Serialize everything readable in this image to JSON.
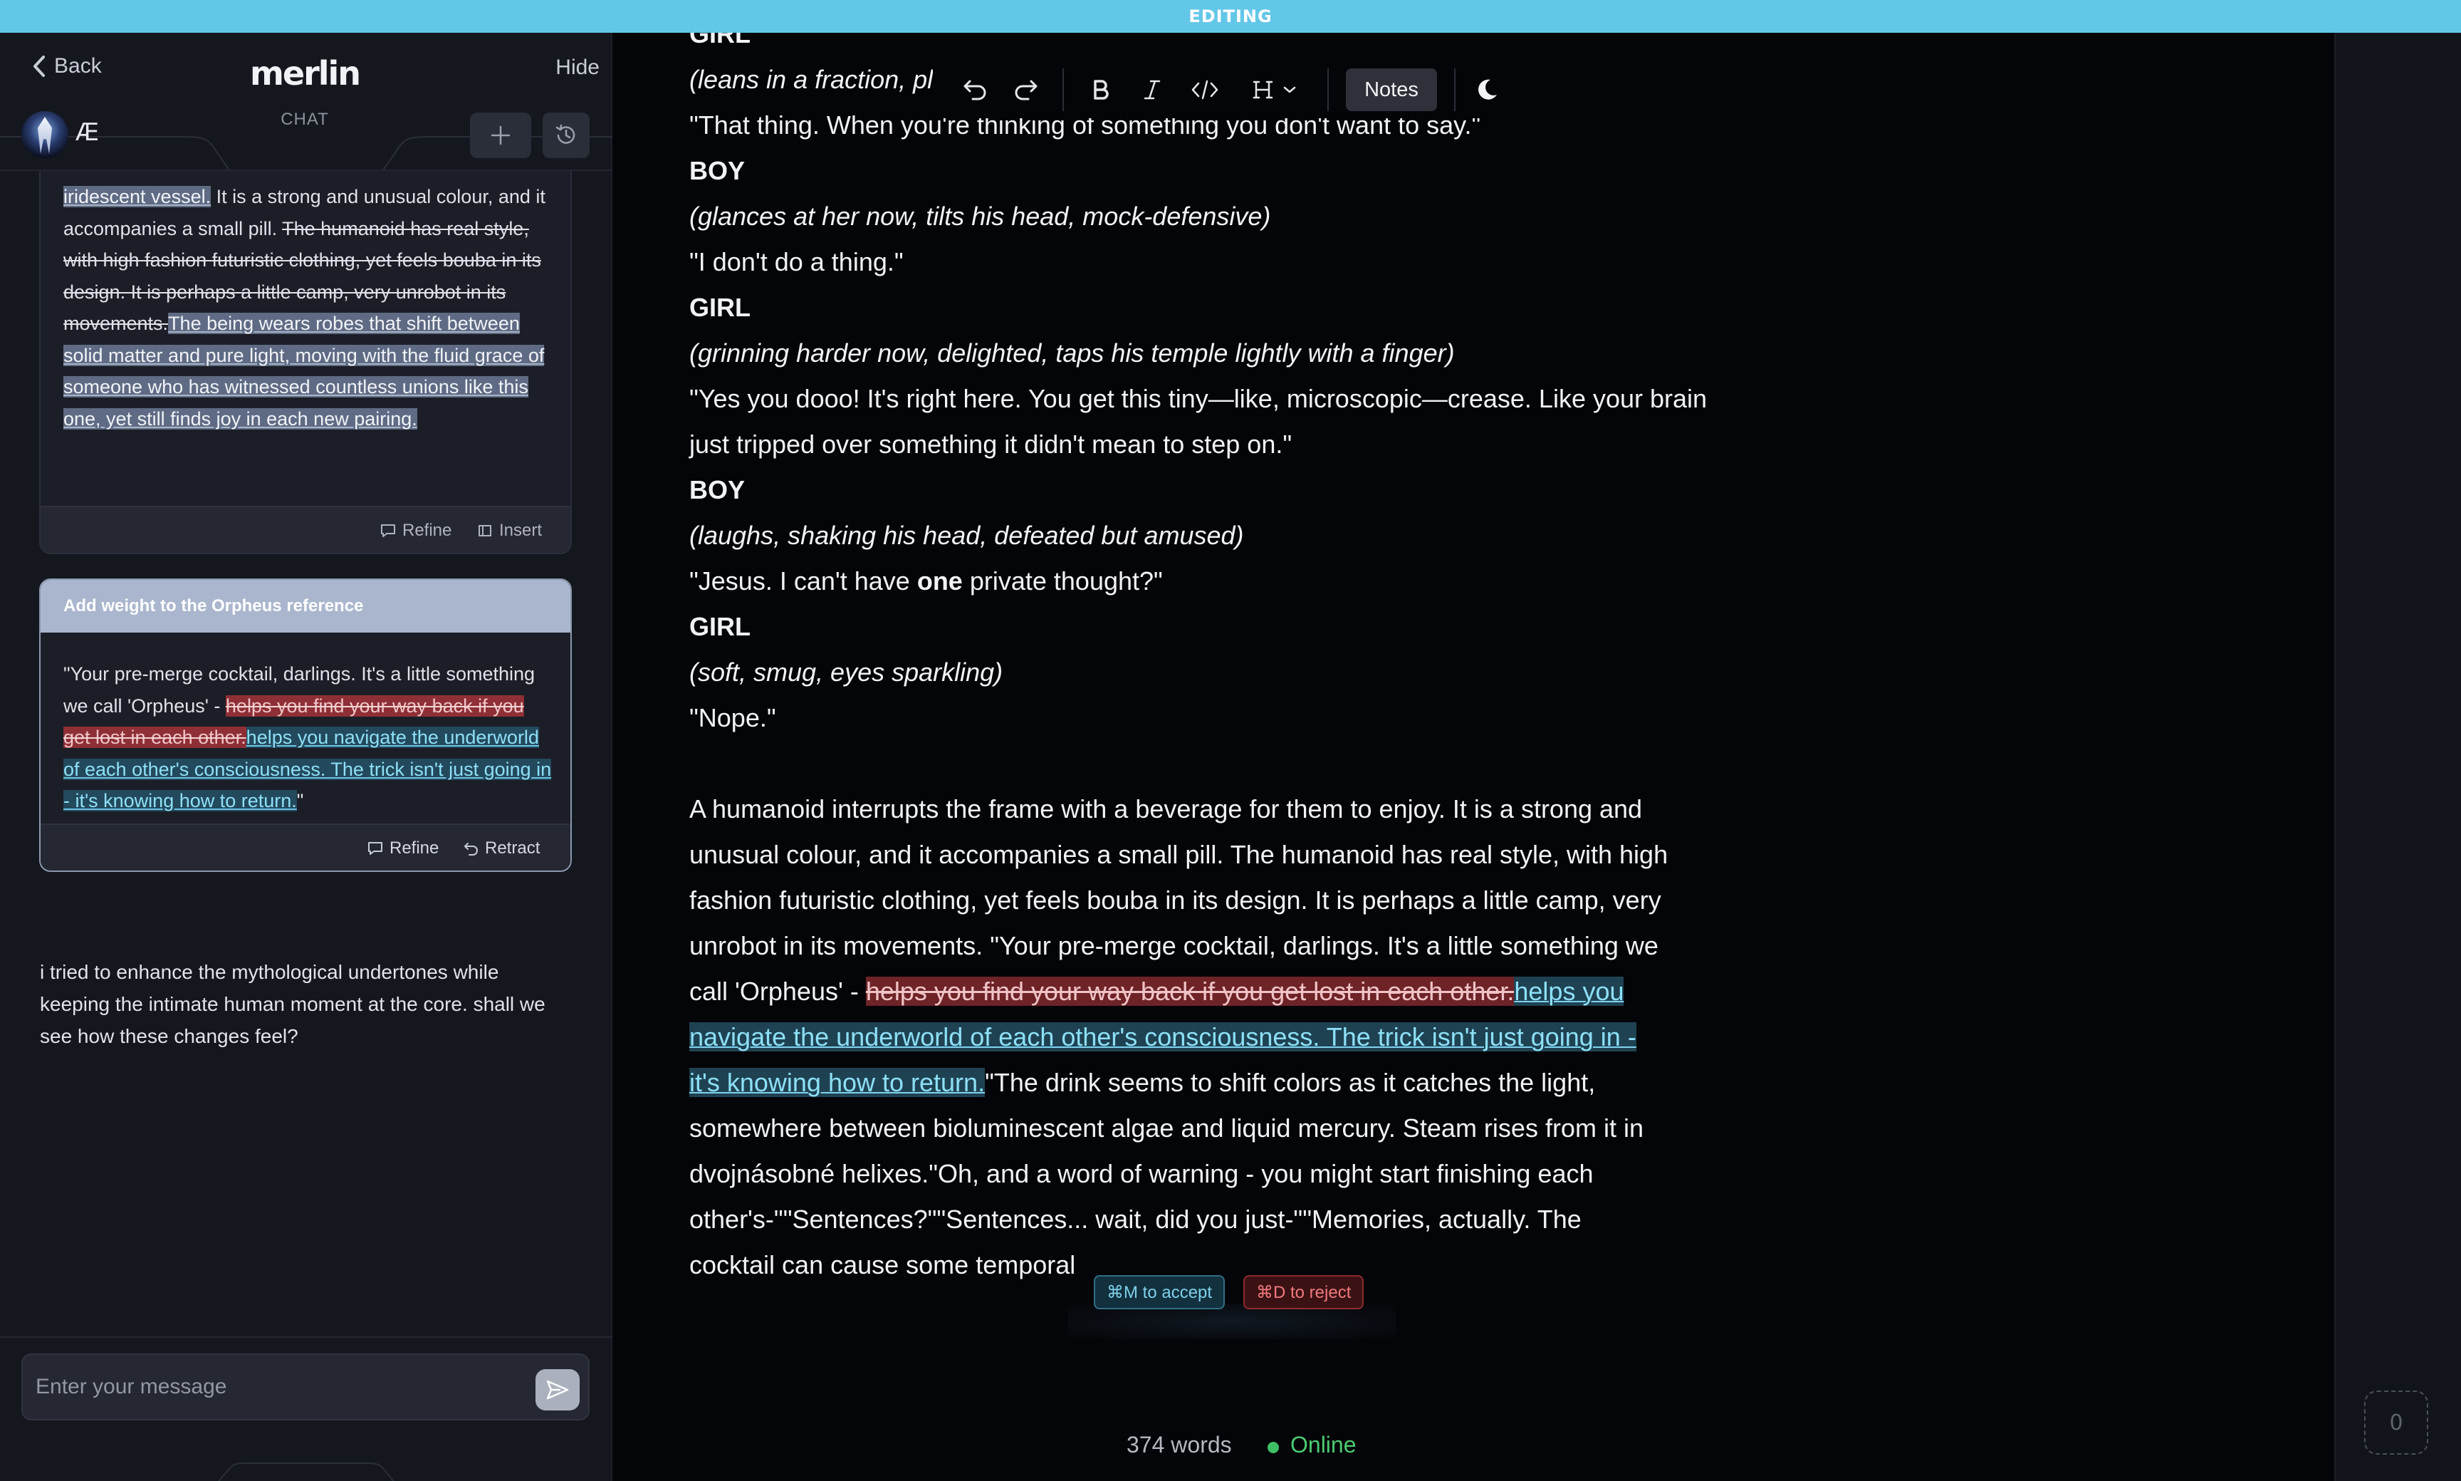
{
  "banner": {
    "mode": "EDITING"
  },
  "sidebar": {
    "back_label": "Back",
    "brand": "merlin",
    "hide_label": "Hide",
    "tab_label": "CHAT",
    "user_initials": "Æ",
    "message_placeholder": "Enter your message"
  },
  "cards": [
    {
      "segments": [
        {
          "kind": "hl",
          "text": "iridescent vessel."
        },
        {
          "kind": "plain",
          "text": " It is a strong and unusual colour, and it accompanies a small pill. "
        },
        {
          "kind": "strike",
          "text": "The humanoid has real style, with high fashion futuristic clothing, yet feels bouba in its design. It is perhaps a little camp, very unrobot in its movements."
        },
        {
          "kind": "hl",
          "text": "The being wears robes that shift between solid matter and pure light, moving with the fluid grace of someone who has witnessed countless unions like this one, yet still finds joy in each new pairing."
        }
      ],
      "refine_label": "Refine",
      "insert_label": "Insert"
    },
    {
      "title": "Add weight to the Orpheus reference",
      "segments": [
        {
          "kind": "plain",
          "text": "\"Your pre-merge cocktail, darlings. It's a little something we call 'Orpheus' - "
        },
        {
          "kind": "strike",
          "text": "helps you find your way back if you get lost in each other."
        },
        {
          "kind": "hl",
          "text": "helps you navigate the underworld of each other's consciousness. The trick isn't just going in - it's knowing how to return."
        },
        {
          "kind": "plain",
          "text": "\""
        }
      ],
      "refine_label": "Refine",
      "retract_label": "Retract"
    }
  ],
  "assistant_message": "i tried to enhance the mythological undertones while keeping the intimate human moment at the core. shall we see how these changes feel?",
  "editor": {
    "lines": [
      {
        "kind": "speaker",
        "text": "GIRL"
      },
      {
        "kind": "direction",
        "text": "(leans in a fraction, pl"
      },
      {
        "kind": "dialogue",
        "text": "\"That thing. When you're thinking of something you don't want to say.\""
      },
      {
        "kind": "speaker",
        "text": "BOY"
      },
      {
        "kind": "direction",
        "text": "(glances at her now, tilts his head, mock-defensive)"
      },
      {
        "kind": "dialogue",
        "text": "\"I don't do a thing.\""
      },
      {
        "kind": "speaker",
        "text": "GIRL"
      },
      {
        "kind": "direction",
        "text": "(grinning harder now, delighted, taps his temple lightly with a finger)"
      },
      {
        "kind": "dialogue",
        "text": "\"Yes you dooo! It's right here. You get this tiny—like, microscopic—crease. Like your brain"
      },
      {
        "kind": "dialogue",
        "text": "just tripped over something it didn't mean to step on.\""
      },
      {
        "kind": "speaker",
        "text": "BOY"
      },
      {
        "kind": "direction",
        "text": "(laughs, shaking his head, defeated but amused)"
      },
      {
        "kind": "dialogue-bold",
        "before": "\"Jesus. I can't have ",
        "bold": "one",
        "after": " private thought?\""
      },
      {
        "kind": "speaker",
        "text": "GIRL"
      },
      {
        "kind": "direction",
        "text": "(soft, smug, eyes sparkling)"
      },
      {
        "kind": "dialogue",
        "text": "\"Nope.\""
      }
    ],
    "paragraph": [
      {
        "kind": "plain",
        "text": "A humanoid interrupts the frame with a beverage for them to enjoy. It is a strong and unusual colour, and it accompanies a small pill. The humanoid has real style, with high fashion futuristic clothing, yet feels bouba in its design. It is perhaps a little camp, very unrobot in its movements. \"Your pre-merge cocktail, darlings. It's a little something we call 'Orpheus' - "
      },
      {
        "kind": "strike",
        "text": "helps you find your way back if you get lost in each other."
      },
      {
        "kind": "hl",
        "text": "helps you navigate the underworld of each other's consciousness. The trick isn't just going in - it's knowing how to return."
      },
      {
        "kind": "plain",
        "text": "\"The drink seems to shift colors as it catches the light, somewhere between bioluminescent algae and liquid mercury. Steam rises from it in dvojnásobné helixes.\"Oh, and a word of warning - you might start finishing each other's-\"\"Sentences?\"\"Sentences... wait, did you just-\"\"Memories, actually. The cocktail can cause some temporal"
      }
    ],
    "toolbar": {
      "notes_label": "Notes"
    },
    "accept_hint": "⌘M to accept",
    "reject_hint": "⌘D to reject"
  },
  "status": {
    "word_count": "374 words",
    "connection": "Online"
  },
  "counter_badge": "0",
  "colors": {
    "banner": "#63c7e8",
    "accept": "#7fd0ea",
    "reject": "#f0797c",
    "online": "#4ccb72",
    "insert_highlight": "#1f4253",
    "delete_highlight": "#6e2327"
  }
}
